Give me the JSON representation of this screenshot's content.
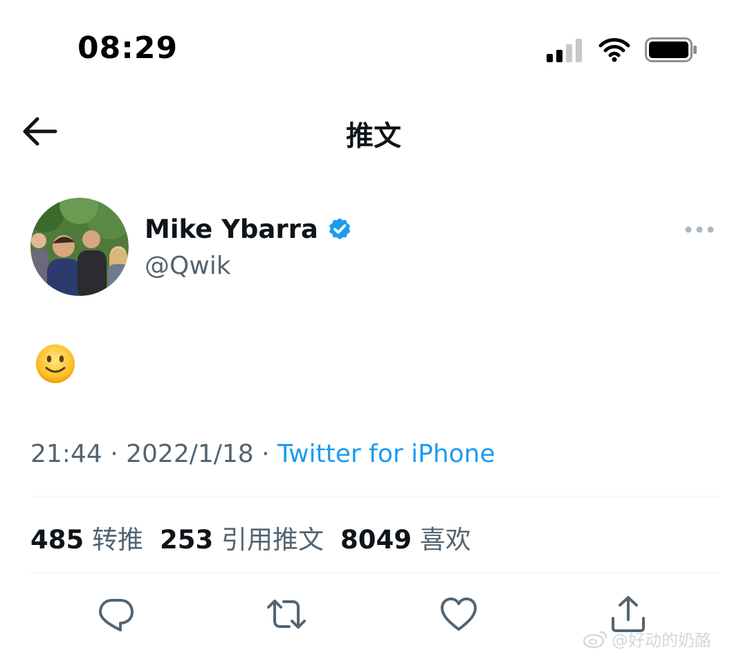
{
  "status_bar": {
    "time": "08:29"
  },
  "header": {
    "title": "推文",
    "back_icon": "arrow-left-icon"
  },
  "author": {
    "name": "Mike Ybarra",
    "handle": "@Qwik",
    "verified": true
  },
  "tweet": {
    "content": "🙂",
    "time": "21:44",
    "separator": "·",
    "date": "2022/1/18",
    "source": "Twitter for iPhone"
  },
  "stats": {
    "retweets_count": "485",
    "retweets_label": "转推",
    "quotes_count": "253",
    "quotes_label": "引用推文",
    "likes_count": "8049",
    "likes_label": "喜欢"
  },
  "actions": [
    "reply-icon",
    "retweet-icon",
    "like-icon",
    "share-icon"
  ],
  "watermark": {
    "text": "@好动的奶酪"
  },
  "colors": {
    "accent": "#1d9bf0",
    "text_primary": "#0f1419",
    "text_secondary": "#536471",
    "divider": "#eff3f4"
  }
}
